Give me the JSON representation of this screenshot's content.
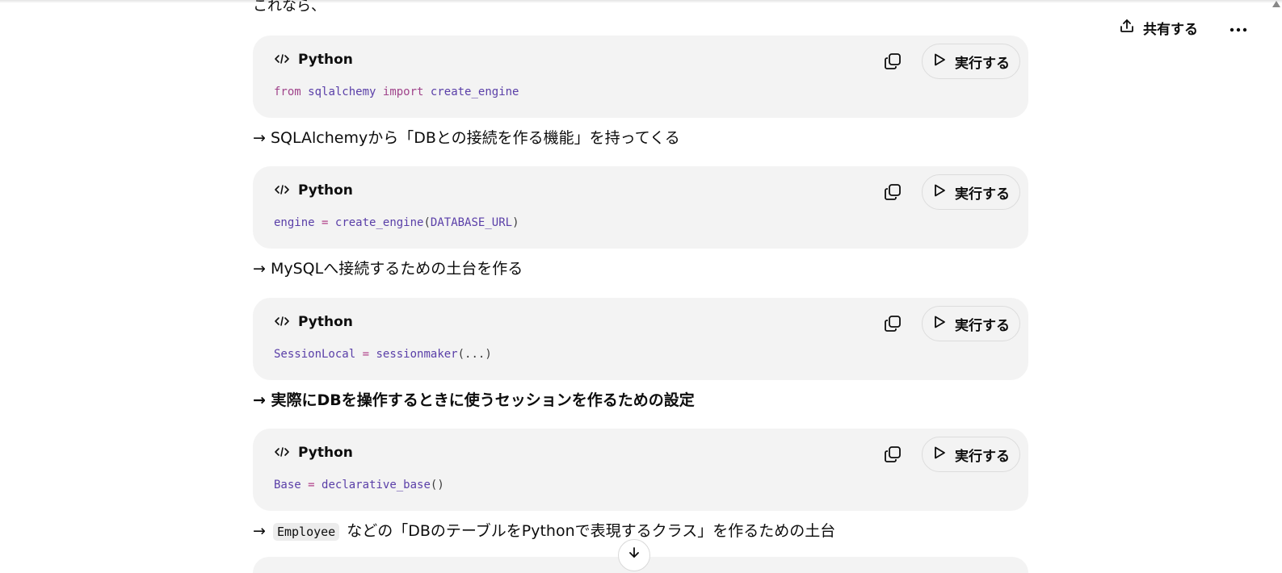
{
  "header": {
    "share_label": "共有する",
    "share_icon": "share-upload-icon",
    "more_icon": "ellipsis-icon"
  },
  "intro_text": "これなら、",
  "code_blocks": [
    {
      "language": "Python",
      "run_label": "実行する",
      "tokens": [
        {
          "t": "from",
          "c": "kw"
        },
        {
          "t": " ",
          "c": "pn"
        },
        {
          "t": "sqlalchemy",
          "c": "id"
        },
        {
          "t": " ",
          "c": "pn"
        },
        {
          "t": "import",
          "c": "kw"
        },
        {
          "t": " ",
          "c": "pn"
        },
        {
          "t": "create_engine",
          "c": "id"
        }
      ]
    },
    {
      "language": "Python",
      "run_label": "実行する",
      "tokens": [
        {
          "t": "engine",
          "c": "id"
        },
        {
          "t": " ",
          "c": "pn"
        },
        {
          "t": "=",
          "c": "op"
        },
        {
          "t": " ",
          "c": "pn"
        },
        {
          "t": "create_engine",
          "c": "id"
        },
        {
          "t": "(",
          "c": "pn"
        },
        {
          "t": "DATABASE_URL",
          "c": "id"
        },
        {
          "t": ")",
          "c": "pn"
        }
      ]
    },
    {
      "language": "Python",
      "run_label": "実行する",
      "tokens": [
        {
          "t": "SessionLocal",
          "c": "id"
        },
        {
          "t": " ",
          "c": "pn"
        },
        {
          "t": "=",
          "c": "op"
        },
        {
          "t": " ",
          "c": "pn"
        },
        {
          "t": "sessionmaker",
          "c": "id"
        },
        {
          "t": "(...)",
          "c": "pn"
        }
      ]
    },
    {
      "language": "Python",
      "run_label": "実行する",
      "tokens": [
        {
          "t": "Base",
          "c": "id"
        },
        {
          "t": " ",
          "c": "pn"
        },
        {
          "t": "=",
          "c": "op"
        },
        {
          "t": " ",
          "c": "pn"
        },
        {
          "t": "declarative_base",
          "c": "id"
        },
        {
          "t": "()",
          "c": "pn"
        }
      ]
    }
  ],
  "explanations": [
    {
      "text": "→ SQLAlchemyから「DBとの接続を作る機能」を持ってくる"
    },
    {
      "text": "→ MySQLへ接続するための土台を作る"
    },
    {
      "text": "→ 実際にDBを操作するときに使うセッションを作るための設定"
    },
    {
      "prefix": "→ ",
      "code": "Employee",
      "suffix": " などの「DBのテーブルをPythonで表現するクラス」を作るための土台"
    }
  ],
  "colors": {
    "code_bg": "#f3f3f3",
    "keyword": "#a0448b",
    "identifier": "#5a3fa8"
  }
}
